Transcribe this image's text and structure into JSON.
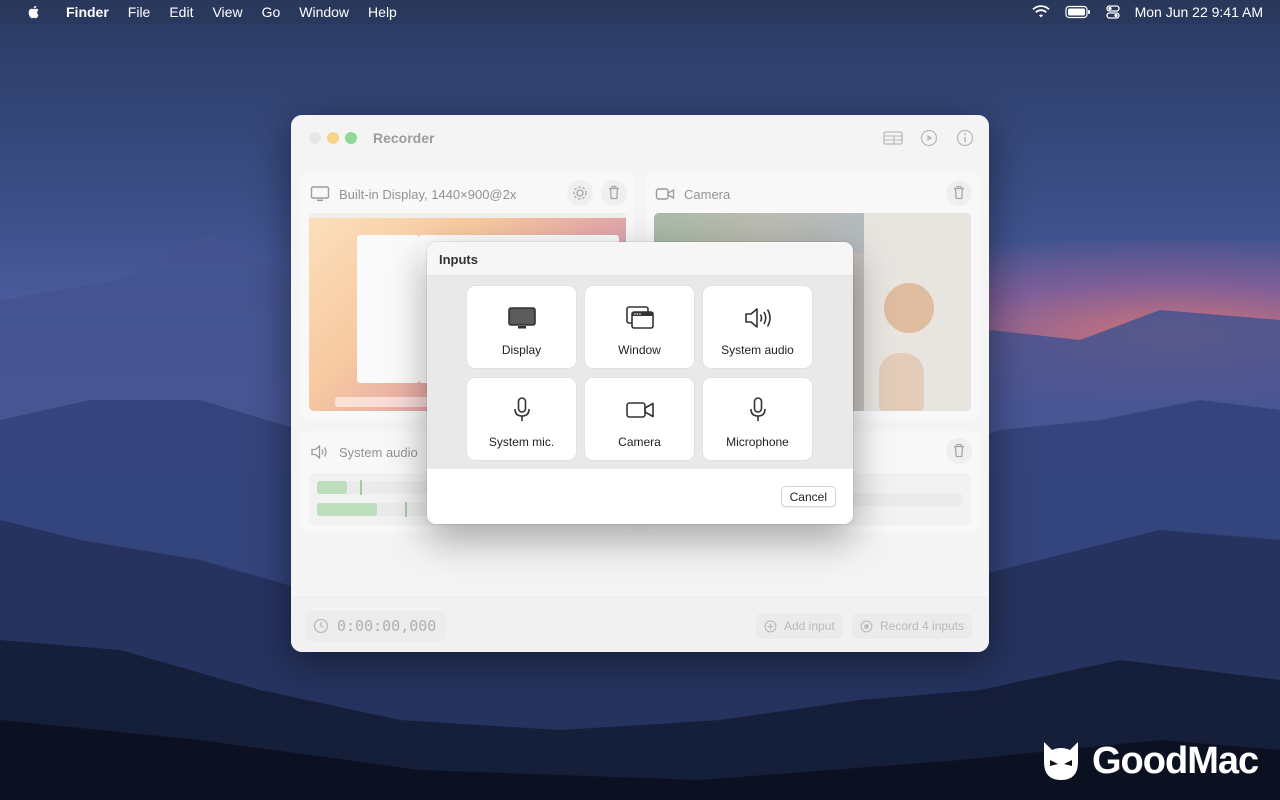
{
  "menubar": {
    "app_name": "Finder",
    "items": [
      "File",
      "Edit",
      "View",
      "Go",
      "Window",
      "Help"
    ],
    "datetime": "Mon Jun 22  9:41 AM",
    "icons": [
      "apple-icon",
      "wifi-icon",
      "battery-icon",
      "control-center-icon"
    ]
  },
  "window": {
    "title": "Recorder",
    "toolbar_icons": [
      "layout-icon",
      "play-icon",
      "info-icon"
    ],
    "cards": {
      "display": {
        "label": "Built-in Display, 1440×900@2x",
        "icon": "display-icon"
      },
      "camera": {
        "label": "Camera",
        "icon": "camera-icon"
      },
      "system_audio": {
        "label": "System audio",
        "icon": "speaker-icon",
        "levels": [
          0.1,
          0.19
        ]
      }
    },
    "timer": "0:00:00,000",
    "add_input_label": "Add input",
    "record_label": "Record 4 inputs"
  },
  "sheet": {
    "title": "Inputs",
    "tiles": [
      {
        "label": "Display",
        "icon": "display-icon"
      },
      {
        "label": "Window",
        "icon": "window-icon"
      },
      {
        "label": "System audio",
        "icon": "speaker-icon"
      },
      {
        "label": "System mic.",
        "icon": "microphone-icon"
      },
      {
        "label": "Camera",
        "icon": "camera-icon"
      },
      {
        "label": "Microphone",
        "icon": "microphone-icon"
      }
    ],
    "cancel_label": "Cancel"
  },
  "watermark": {
    "brand": "GoodMac"
  }
}
